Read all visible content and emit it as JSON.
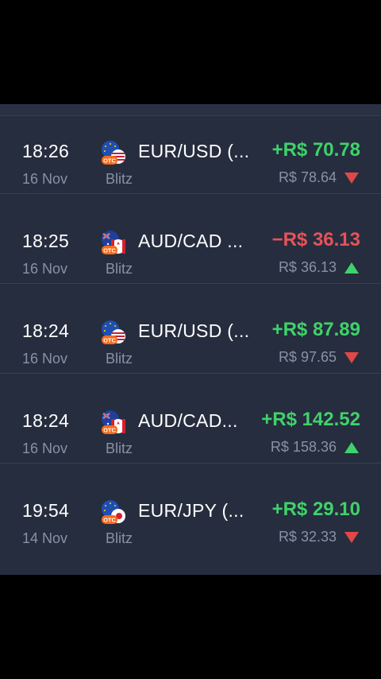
{
  "trades": [
    {
      "time": "18:26",
      "date": "16 Nov",
      "asset": "EUR/USD (...",
      "mode": "Blitz",
      "profit": "+R$ 70.78",
      "amount": "R$ 78.64",
      "direction": "down",
      "profit_sign": "pos",
      "flag": "eur-usd-otc-icon"
    },
    {
      "time": "18:25",
      "date": "16 Nov",
      "asset": "AUD/CAD ...",
      "mode": "Blitz",
      "profit": "−R$ 36.13",
      "amount": "R$ 36.13",
      "direction": "up",
      "profit_sign": "neg",
      "flag": "aud-cad-otc-icon"
    },
    {
      "time": "18:24",
      "date": "16 Nov",
      "asset": "EUR/USD (...",
      "mode": "Blitz",
      "profit": "+R$ 87.89",
      "amount": "R$ 97.65",
      "direction": "down",
      "profit_sign": "pos",
      "flag": "eur-usd-otc-icon"
    },
    {
      "time": "18:24",
      "date": "16 Nov",
      "asset": "AUD/CAD...",
      "mode": "Blitz",
      "profit": "+R$ 142.52",
      "amount": "R$ 158.36",
      "direction": "up",
      "profit_sign": "pos",
      "flag": "aud-cad-otc-icon"
    },
    {
      "time": "19:54",
      "date": "14 Nov",
      "asset": "EUR/JPY (...",
      "mode": "Blitz",
      "profit": "+R$ 29.10",
      "amount": "R$ 32.33",
      "direction": "down",
      "profit_sign": "pos",
      "flag": "eur-jpy-otc-icon"
    }
  ],
  "otc_label": "OTC",
  "colors": {
    "positive": "#3fd26a",
    "negative": "#e6525a",
    "panel": "#262d3e",
    "muted": "#8a91a4"
  }
}
